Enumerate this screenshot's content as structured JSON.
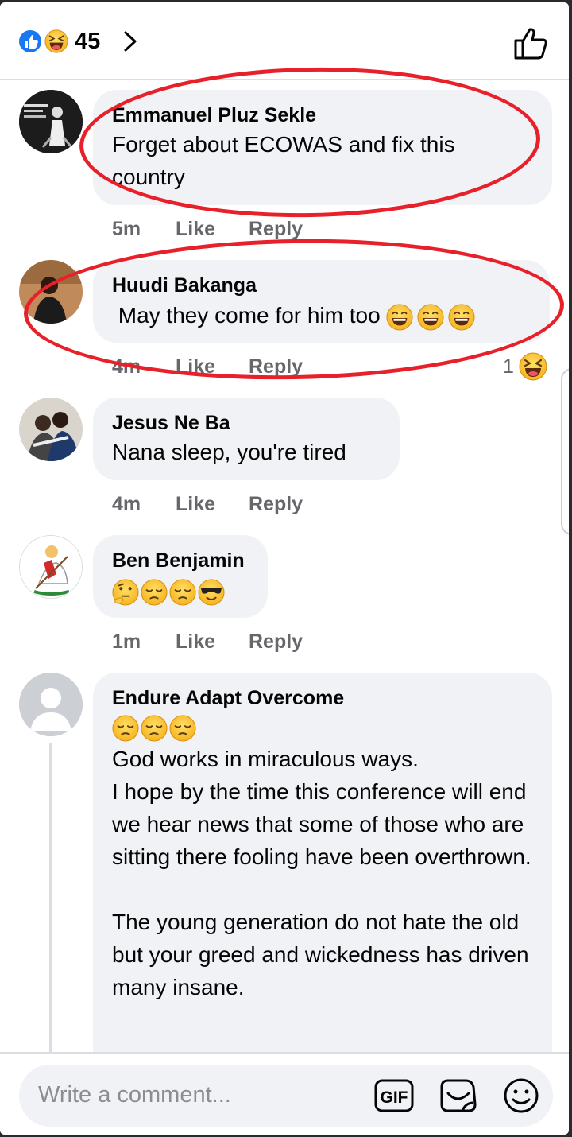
{
  "header": {
    "reaction_count": "45",
    "reaction_icons": [
      "like-icon",
      "haha-icon"
    ],
    "like_icon": "thumbs-up-outline-icon"
  },
  "comments": [
    {
      "author": "Emmanuel Pluz Sekle",
      "text": "Forget about ECOWAS and fix this country",
      "time": "5m",
      "like": "Like",
      "reply": "Reply"
    },
    {
      "author": "Huudi Bakanga",
      "text": " May they come for him too",
      "emojis": [
        "grin",
        "grin",
        "grin"
      ],
      "time": "4m",
      "like": "Like",
      "reply": "Reply",
      "reaction_count": "1",
      "reaction_icon": "haha-icon"
    },
    {
      "author": "Jesus Ne Ba",
      "text": "Nana sleep, you're tired",
      "time": "4m",
      "like": "Like",
      "reply": "Reply"
    },
    {
      "author": "Ben Benjamin",
      "emojis": [
        "thinking",
        "pensive",
        "pensive",
        "sunglasses"
      ],
      "time": "1m",
      "like": "Like",
      "reply": "Reply"
    },
    {
      "author": "Endure Adapt Overcome",
      "emojis": [
        "pensive",
        "pensive",
        "pensive"
      ],
      "text": "God works in miraculous ways.\nI hope by the time this conference will end we hear news that some of those who are sitting there fooling have been overthrown.\n\nThe young generation do not hate the old but your greed and wickedness has driven many insane."
    }
  ],
  "composer": {
    "placeholder": "Write a comment...",
    "gif_label": "GIF",
    "icons": [
      "gif-icon",
      "sticker-icon",
      "emoji-icon"
    ]
  },
  "colors": {
    "accent": "#1877f2",
    "bubble": "#f0f2f5",
    "meta_text": "#65676b",
    "annotation_red": "#e8202a"
  }
}
